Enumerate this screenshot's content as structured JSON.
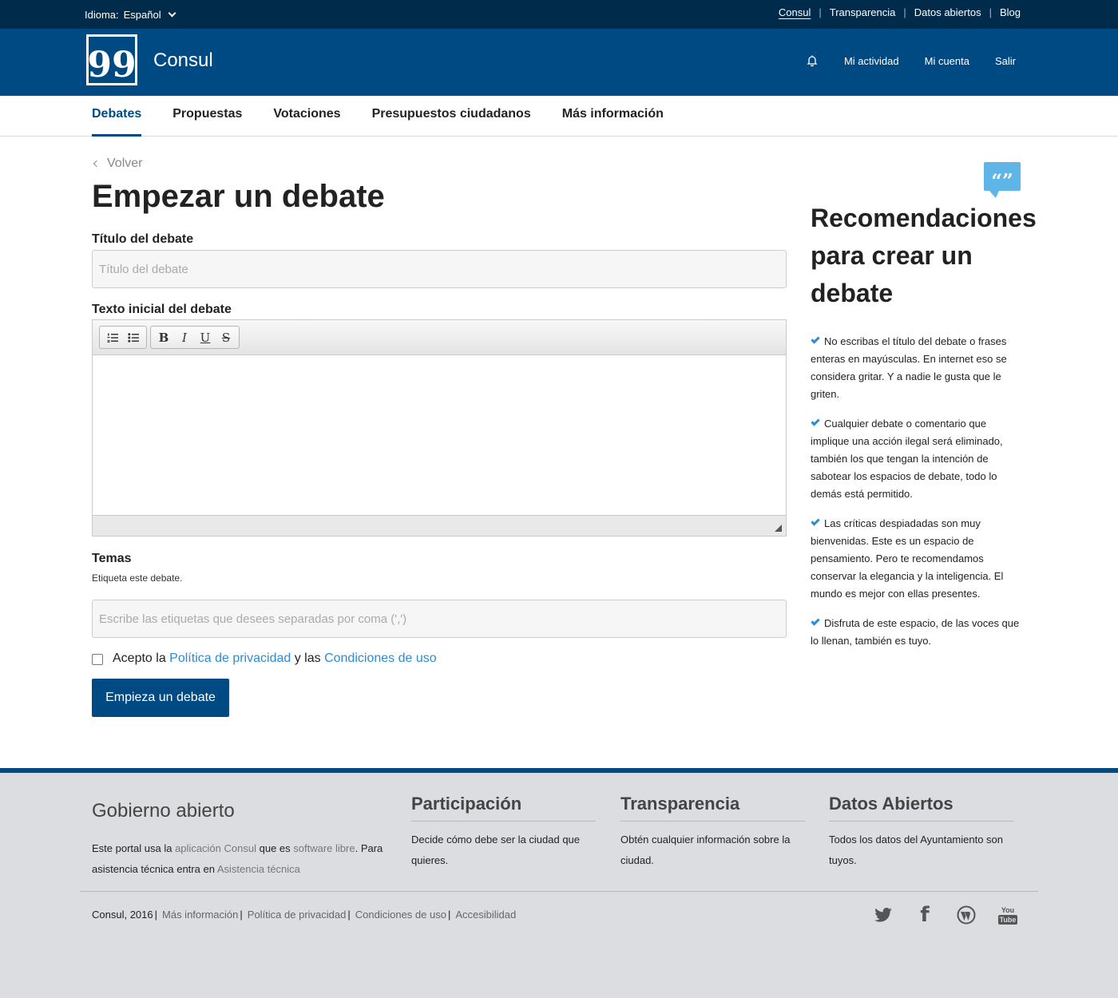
{
  "topbar": {
    "language_label": "Idioma:",
    "language_value": "Español",
    "links": [
      "Consul",
      "Transparencia",
      "Datos abiertos",
      "Blog"
    ]
  },
  "header": {
    "logo_glyph": "99",
    "site_name": "Consul",
    "user_nav": [
      "Mi actividad",
      "Mi cuenta",
      "Salir"
    ]
  },
  "main_nav": [
    "Debates",
    "Propuestas",
    "Votaciones",
    "Presupuestos ciudadanos",
    "Más información"
  ],
  "page": {
    "back_label": "Volver",
    "title": "Empezar un debate",
    "title_label": "Título del debate",
    "title_placeholder": "Título del debate",
    "text_label": "Texto inicial del debate",
    "toolbar_icons": [
      "numbered-list-icon",
      "bullet-list-icon",
      "bold-icon",
      "italic-icon",
      "underline-icon",
      "strikethrough-icon"
    ],
    "toolbar_glyphs": {
      "bold": "B",
      "italic": "I",
      "underline": "U",
      "strike": "S"
    },
    "topics_label": "Temas",
    "topics_hint": "Etiqueta este debate.",
    "topics_placeholder": "Escribe las etiquetas que desees separadas por coma (',')",
    "terms_prefix": "Acepto la",
    "terms_privacy": "Política de privacidad",
    "terms_middle": "y las",
    "terms_conditions": "Condiciones de uso",
    "submit_label": "Empieza un debate"
  },
  "sidebar": {
    "icon_glyph": "“”",
    "title": "Recomendaciones para crear un debate",
    "recommendations": [
      "No escribas el título del debate o frases enteras en mayúsculas. En internet eso se considera gritar. Y a nadie le gusta que le griten.",
      "Cualquier debate o comentario que implique una acción ilegal será eliminado, también los que tengan la intención de sabotear los espacios de debate, todo lo demás está permitido.",
      "Las críticas despiadadas son muy bienvenidas. Este es un espacio de pensamiento. Pero te recomendamos conservar la elegancia y la inteligencia. El mundo es mejor con ellas presentes.",
      "Disfruta de este espacio, de las voces que lo llenan, también es tuyo."
    ]
  },
  "footer": {
    "brand": "Gobierno abierto",
    "desc_1": "Este portal usa la",
    "desc_link_1": "aplicación Consul",
    "desc_2": "que es",
    "desc_link_2": "software libre",
    "desc_3": ". Para asistencia técnica entra en",
    "desc_link_3": "Asistencia técnica",
    "columns": [
      {
        "title": "Participación",
        "text": "Decide cómo debe ser la ciudad que quieres."
      },
      {
        "title": "Transparencia",
        "text": "Obtén cualquier información sobre la ciudad."
      },
      {
        "title": "Datos Abiertos",
        "text": "Todos los datos del Ayuntamiento son tuyos."
      }
    ],
    "copyright": "Consul, 2016",
    "bottom_links": [
      "Más información",
      "Política de privacidad",
      "Condiciones de uso",
      "Accesibilidad"
    ],
    "social": [
      "twitter-icon",
      "facebook-icon",
      "wordpress-icon",
      "youtube-icon"
    ],
    "social_glyphs": {
      "facebook": "f",
      "youtube_top": "You",
      "youtube_bottom": "Tube"
    }
  },
  "colors": {
    "topbar": "#002b4a",
    "header": "#004a83",
    "accent": "#004a83",
    "link": "#2b8cd4",
    "footer_bg": "#dcdde0"
  }
}
